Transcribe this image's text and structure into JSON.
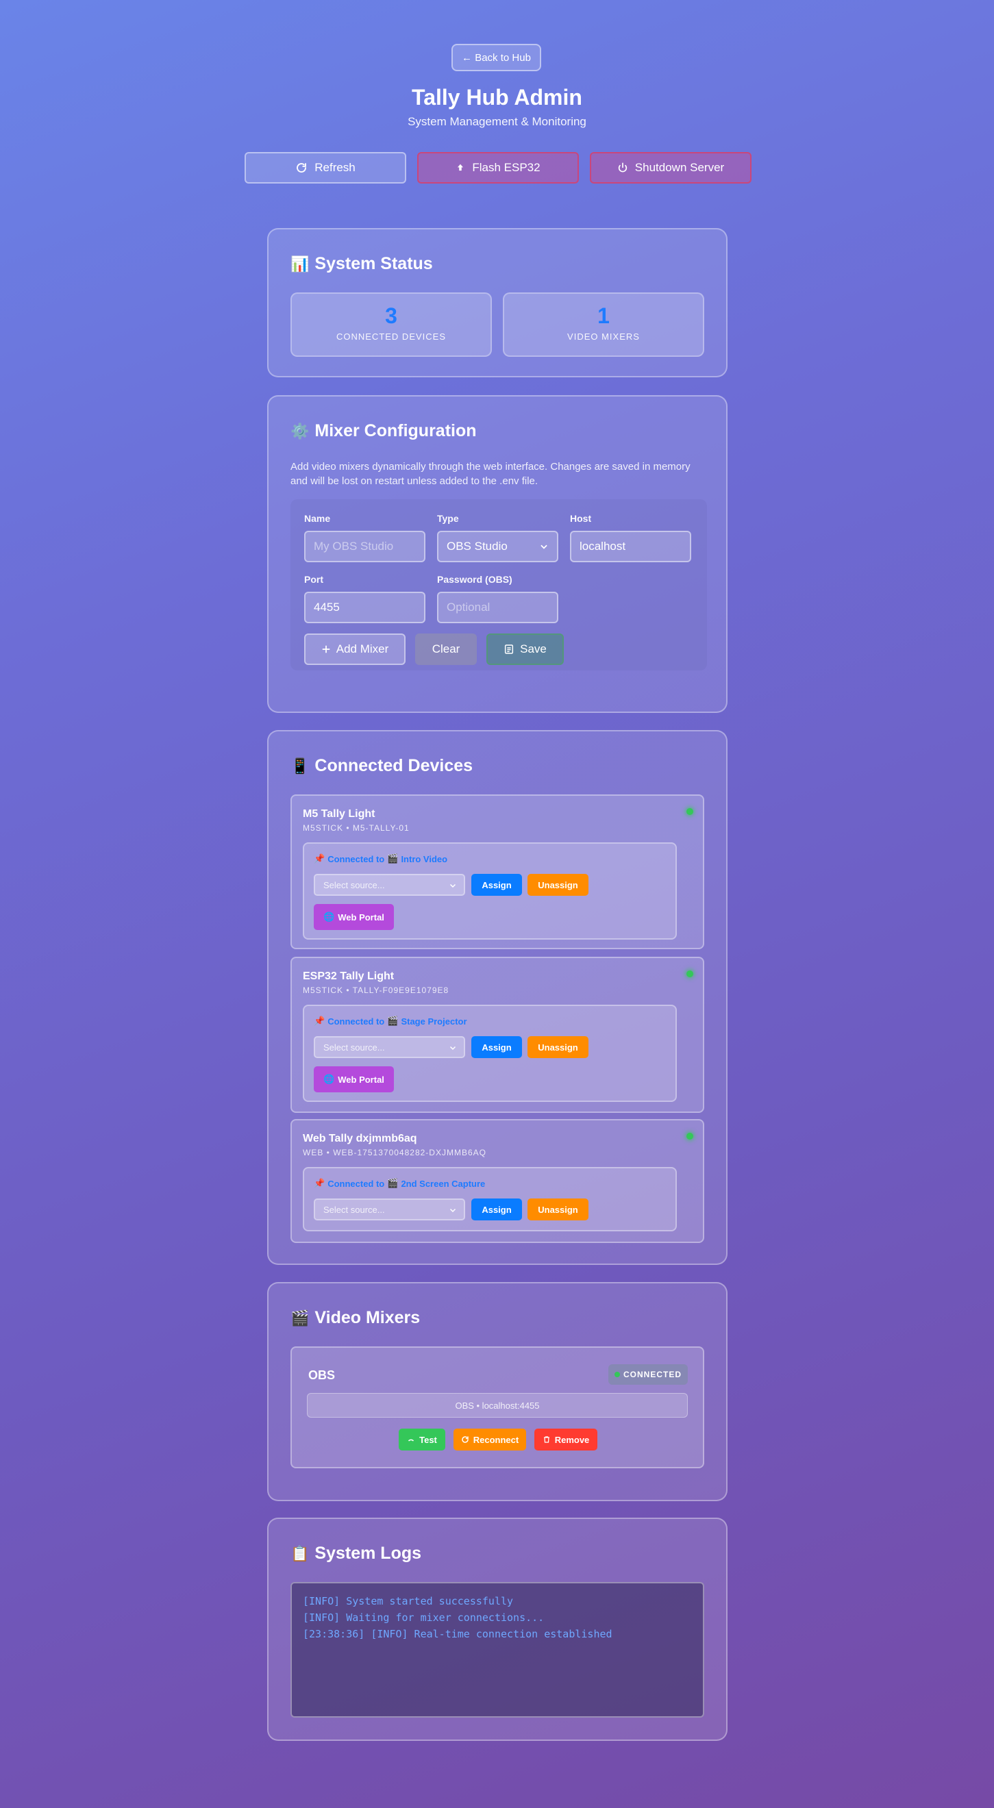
{
  "header": {
    "back_label": "← Back to Hub",
    "title": "Tally Hub Admin",
    "subtitle": "System Management & Monitoring"
  },
  "top_actions": {
    "refresh": "Refresh",
    "flash": "Flash ESP32",
    "shutdown": "Shutdown Server"
  },
  "status": {
    "title": "System Status",
    "icon": "chart-icon",
    "stats": [
      {
        "value": "3",
        "label": "CONNECTED DEVICES"
      },
      {
        "value": "1",
        "label": "VIDEO MIXERS"
      }
    ]
  },
  "mixer_config": {
    "title": "Mixer Configuration",
    "description": "Add video mixers dynamically through the web interface. Changes are saved in memory and will be lost on restart unless added to the .env file.",
    "fields": {
      "name_label": "Name",
      "name_placeholder": "My OBS Studio",
      "type_label": "Type",
      "type_value": "OBS Studio",
      "host_label": "Host",
      "host_value": "localhost",
      "port_label": "Port",
      "port_value": "4455",
      "password_label": "Password (OBS)",
      "password_placeholder": "Optional"
    },
    "buttons": {
      "add": "Add Mixer",
      "clear": "Clear",
      "save": "Save"
    }
  },
  "devices": {
    "title": "Connected Devices",
    "items": [
      {
        "name": "M5 Tally Light",
        "sub": "M5STICK • M5-TALLY-01",
        "connected_prefix": "Connected to",
        "source": "Intro Video",
        "select_placeholder": "Select source...",
        "assign": "Assign",
        "unassign": "Unassign",
        "portal": "Web Portal"
      },
      {
        "name": "ESP32 Tally Light",
        "sub": "M5STICK • TALLY-F09E9E1079E8",
        "connected_prefix": "Connected to",
        "source": "Stage Projector",
        "select_placeholder": "Select source...",
        "assign": "Assign",
        "unassign": "Unassign",
        "portal": "Web Portal"
      },
      {
        "name": "Web Tally dxjmmb6aq",
        "sub": "WEB • WEB-1751370048282-DXJMMB6AQ",
        "connected_prefix": "Connected to",
        "source": "2nd Screen Capture",
        "select_placeholder": "Select source...",
        "assign": "Assign",
        "unassign": "Unassign"
      }
    ]
  },
  "mixers": {
    "title": "Video Mixers",
    "items": [
      {
        "name": "OBS",
        "status": "CONNECTED",
        "host": "OBS • localhost:4455",
        "test": "Test",
        "reconnect": "Reconnect",
        "remove": "Remove"
      }
    ]
  },
  "logs": {
    "title": "System Logs",
    "lines": [
      "[INFO] System started successfully",
      "[INFO] Waiting for mixer connections...",
      "[23:38:36] [INFO] Real-time connection established"
    ]
  },
  "colors": {
    "accent_blue": "#1e7bff",
    "assign": "#0a7cff",
    "unassign": "#ff8c00",
    "portal": "#b44adc",
    "test": "#34c759",
    "remove": "#ff3b30",
    "online": "#34c759"
  }
}
